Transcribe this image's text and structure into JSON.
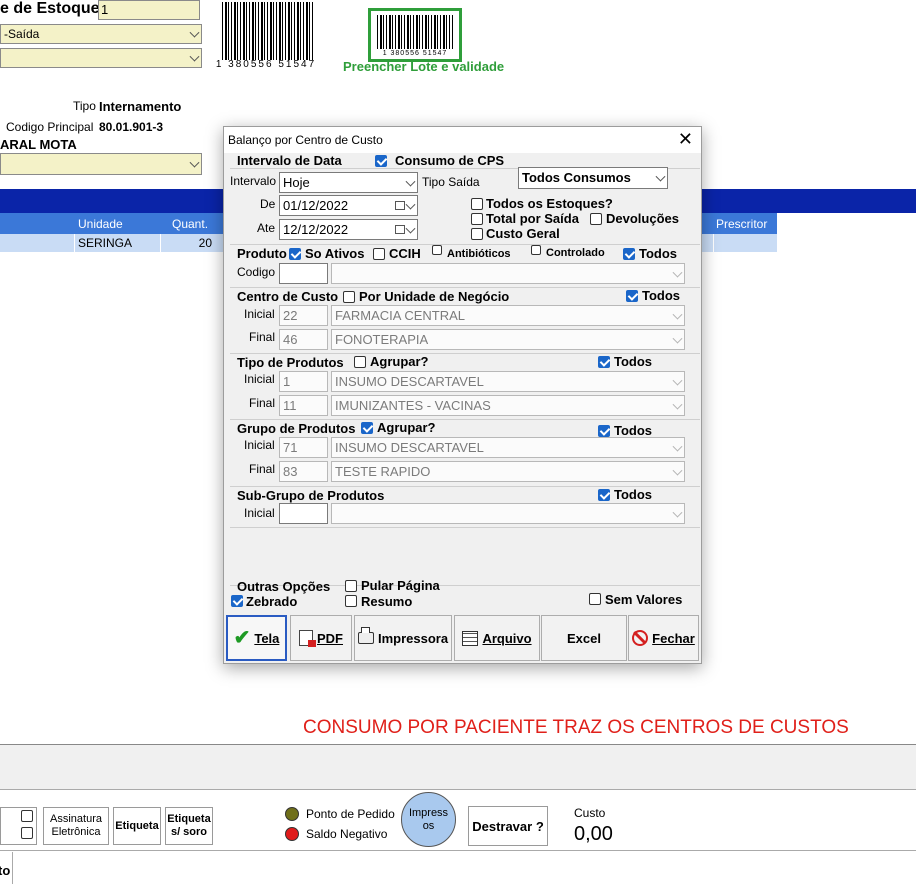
{
  "background": {
    "stock_label": "e de Estoque",
    "stock_value": "1",
    "select_1": "-Saída",
    "select_2": "",
    "barcode_digits": "1 380556 51547",
    "barcode2_digits": "1 380556 51547",
    "fill_lot_link": "Preencher Lote e validade",
    "tipo_label": "Tipo",
    "tipo_value": "Internamento",
    "codigo_label": "Codigo Principal",
    "codigo_value": "80.01.901-3",
    "patient_name": "ARAL MOTA",
    "table": {
      "headers": [
        "Unidade",
        "Quant.",
        "Prescritor"
      ],
      "row": {
        "unidade": "SERINGA",
        "quant": "20"
      }
    },
    "annotation": "CONSUMO POR PACIENTE TRAZ OS CENTROS DE CUSTOS",
    "bottom": {
      "assinatura": "Assinatura Eletrônica",
      "etiqueta": "Etiqueta",
      "etiqueta_soro": "Etiqueta s/ soro",
      "ponto_pedido": "Ponto de Pedido",
      "saldo_negativo": "Saldo Negativo",
      "impressos": "Impressos",
      "destravar": "Destravar ?",
      "custo_label": "Custo",
      "custo_value": "0,00",
      "tab_fragment": "to"
    },
    "colors": {
      "header_bar": "#0a24a8",
      "table_header": "#3b78d8",
      "selected_row": "#c9dcf5",
      "annotation": "#e0201a",
      "barcode_frame": "#2f9e3a",
      "dot_olive": "#6f6f1a",
      "dot_red": "#e01b1b",
      "impressos_bg": "#a9c9ee"
    }
  },
  "dialog": {
    "title": "Balanço por Centro de Custo",
    "intervalo_data": "Intervalo de Data",
    "consumo_cps": "Consumo de CPS",
    "intervalo_label": "Intervalo",
    "intervalo_value": "Hoje",
    "tipo_saida_label": "Tipo Saída",
    "tipo_saida_value": "Todos Consumos",
    "de_label": "De",
    "de_value": "01/12/2022",
    "ate_label": "Ate",
    "ate_value": "12/12/2022",
    "todos_estoques": "Todos os Estoques?",
    "total_saida": "Total por Saída",
    "devolucoes": "Devoluções",
    "custo_geral": "Custo Geral",
    "produto_label": "Produto",
    "so_ativos": "So Ativos",
    "ccih": "CCIH",
    "antibioticos": "Antibióticos",
    "controlado": "Controlado",
    "todos": "Todos",
    "codigo_label": "Codigo",
    "centro_custo": "Centro de Custo",
    "por_unidade": "Por Unidade de Negócio",
    "inicial_label": "Inicial",
    "final_label": "Final",
    "cc_inicial_code": "22",
    "cc_inicial_name": "FARMACIA CENTRAL",
    "cc_final_code": "46",
    "cc_final_name": "FONOTERAPIA",
    "tipo_produtos": "Tipo de Produtos",
    "agrupar": "Agrupar?",
    "tp_inicial_code": "1",
    "tp_inicial_name": "INSUMO DESCARTAVEL",
    "tp_final_code": "11",
    "tp_final_name": "IMUNIZANTES - VACINAS",
    "grupo_produtos": "Grupo de Produtos",
    "gp_inicial_code": "71",
    "gp_inicial_name": "INSUMO DESCARTAVEL",
    "gp_final_code": "83",
    "gp_final_name": "TESTE RAPIDO",
    "subgrupo": "Sub-Grupo de Produtos",
    "outras_opcoes": "Outras Opções",
    "pular_pagina": "Pular Página",
    "zebrado": "Zebrado",
    "resumo": "Resumo",
    "sem_valores": "Sem Valores",
    "buttons": {
      "tela": "Tela",
      "pdf": "PDF",
      "impressora": "Impressora",
      "arquivo": "Arquivo",
      "excel": "Excel",
      "fechar": "Fechar"
    }
  }
}
